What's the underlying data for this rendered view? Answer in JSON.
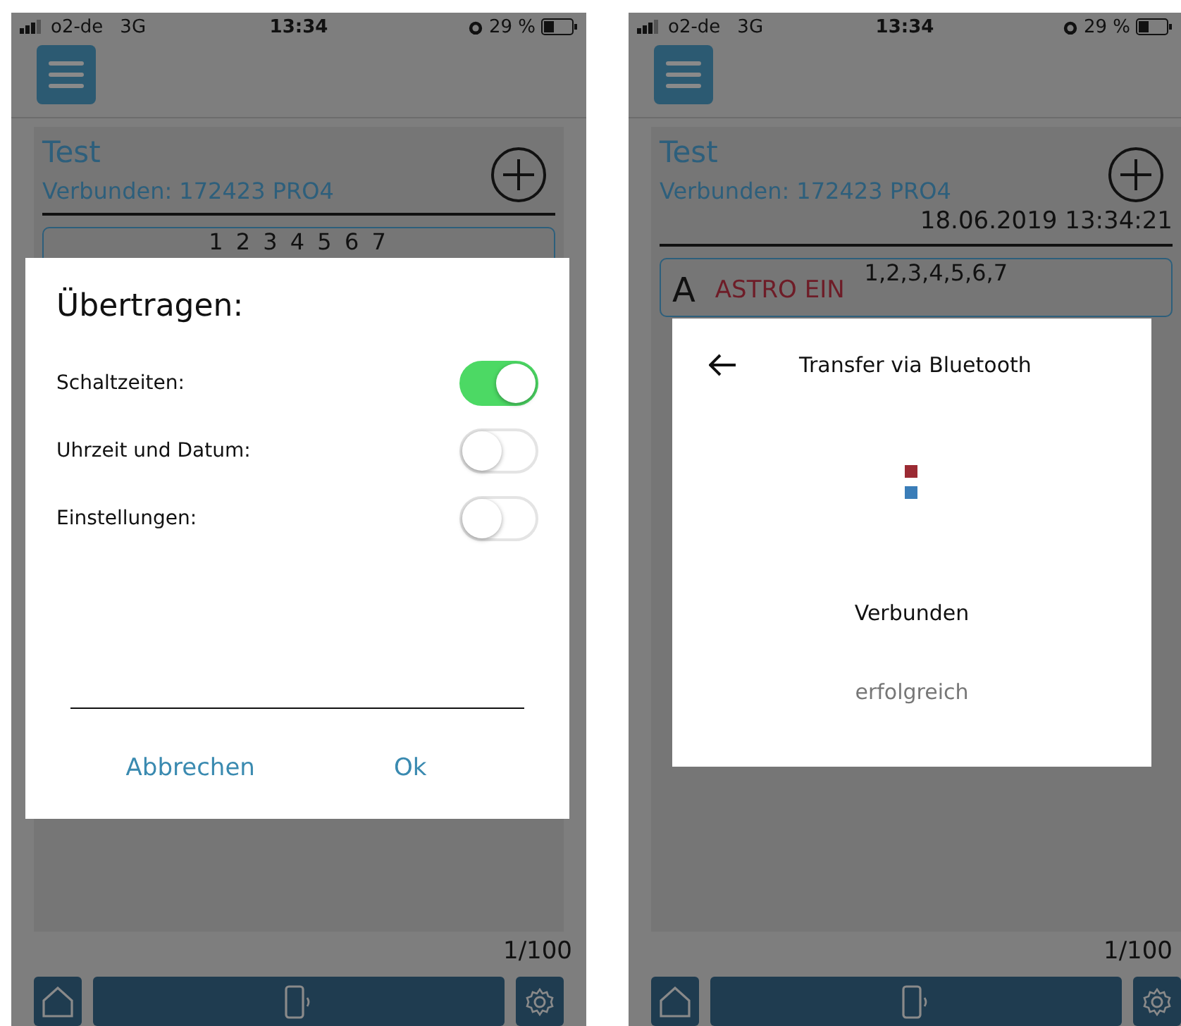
{
  "screens": [
    {
      "status_bar": {
        "carrier": "o2-de",
        "network": "3G",
        "time": "13:34",
        "battery": "29 %"
      },
      "device": {
        "title": "Test",
        "connection": "Verbunden: 172423 PRO4"
      },
      "entries": [
        {
          "kind": "days",
          "days": "1 2 3 4 5 6 7"
        }
      ],
      "counter": "1/100",
      "dialog": {
        "kind": "settings",
        "title": "Übertragen:",
        "options": [
          {
            "label": "Schaltzeiten:",
            "on": true
          },
          {
            "label": "Uhrzeit und Datum:",
            "on": false
          },
          {
            "label": "Einstellungen:",
            "on": false
          }
        ],
        "buttons": [
          "Abbrechen",
          "Ok"
        ]
      }
    },
    {
      "status_bar": {
        "carrier": "o2-de",
        "network": "3G",
        "time": "13:34",
        "battery": "29 %"
      },
      "device": {
        "title": "Test",
        "connection": "Verbunden: 172423 PRO4",
        "datetime": "18.06.2019 13:34:21"
      },
      "entries": [
        {
          "kind": "program",
          "letter": "A",
          "mode": "ASTRO EIN",
          "days": "1,2,3,4,5,6,7"
        }
      ],
      "counter": "1/100",
      "dialog": {
        "kind": "transfer",
        "title": "Transfer via Bluetooth",
        "status": "Verbunden",
        "detail": "erfolgreich"
      }
    }
  ]
}
